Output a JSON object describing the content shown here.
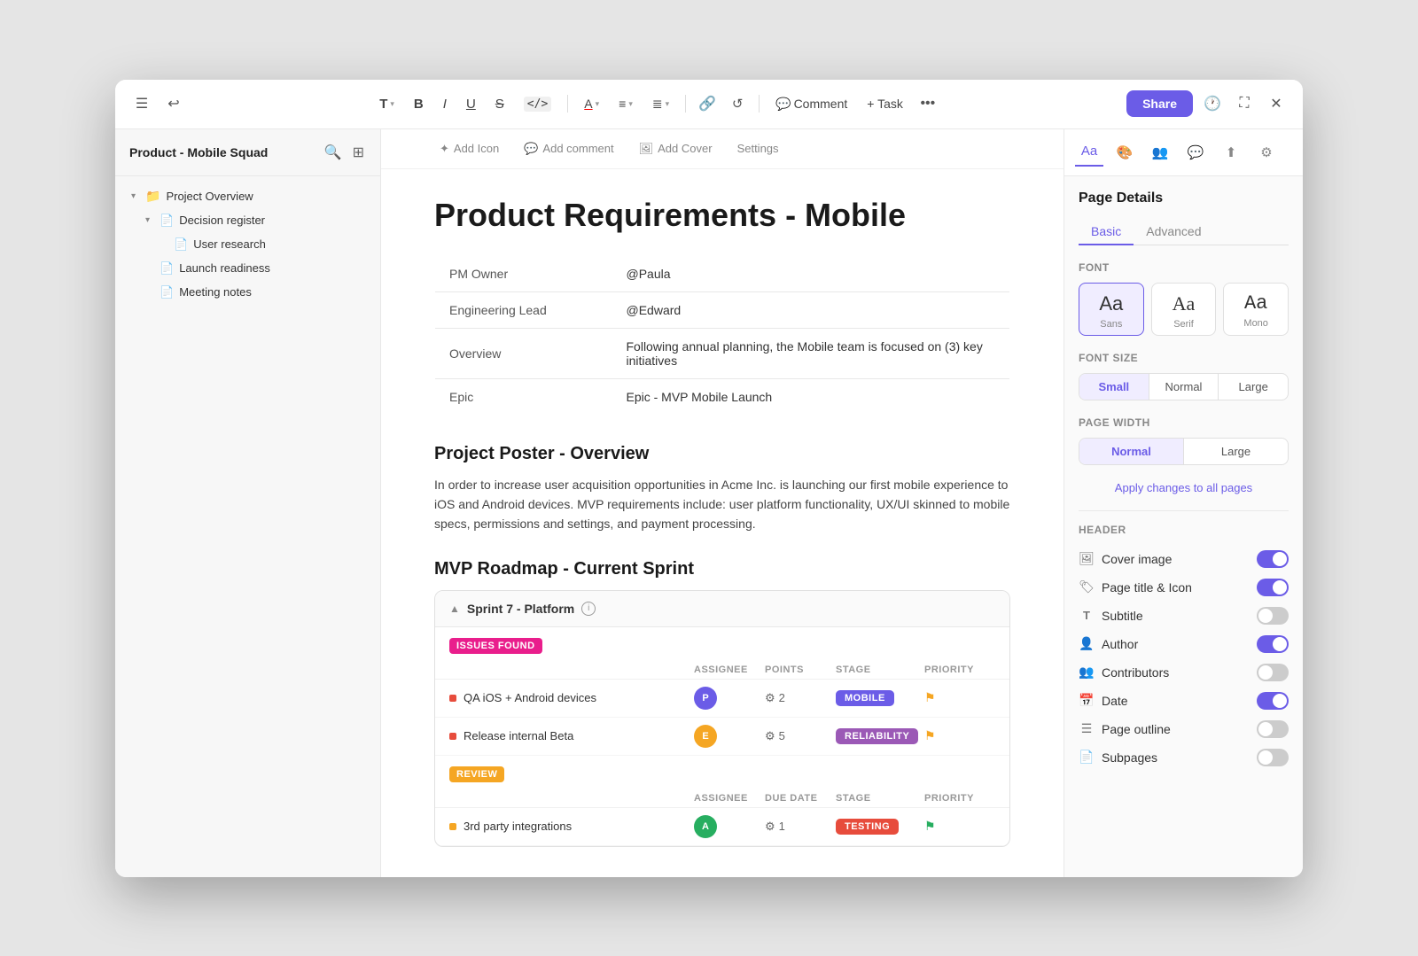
{
  "window": {
    "title": "Product - Mobile Squad"
  },
  "toolbar": {
    "undo_label": "↩",
    "menu_label": "☰",
    "text_label": "T",
    "bold_label": "B",
    "italic_label": "I",
    "underline_label": "U",
    "strike_label": "S",
    "code_label": "</>",
    "font_color_label": "A",
    "align_label": "≡",
    "list_label": "≣",
    "link_label": "🔗",
    "loop_label": "↺",
    "comment_label": "Comment",
    "task_label": "+ Task",
    "more_label": "•••",
    "share_label": "Share",
    "history_label": "🕐",
    "expand_label": "⛶",
    "close_label": "✕"
  },
  "sidebar": {
    "title": "Product - Mobile Squad",
    "tree": [
      {
        "id": "project-overview",
        "label": "Project Overview",
        "type": "folder",
        "expanded": true,
        "level": 0,
        "children": [
          {
            "id": "decision-register",
            "label": "Decision register",
            "type": "page",
            "level": 1,
            "expanded": true,
            "children": [
              {
                "id": "user-research",
                "label": "User research",
                "type": "page",
                "level": 2
              }
            ]
          },
          {
            "id": "launch-readiness",
            "label": "Launch readiness",
            "type": "page",
            "level": 1
          },
          {
            "id": "meeting-notes",
            "label": "Meeting notes",
            "type": "page",
            "level": 1
          }
        ]
      }
    ]
  },
  "doc_toolbar": {
    "add_icon": "Add Icon",
    "add_comment": "Add comment",
    "add_cover": "Add Cover",
    "settings": "Settings"
  },
  "doc": {
    "title": "Product Requirements - Mobile",
    "info_rows": [
      {
        "label": "PM Owner",
        "value": "@Paula"
      },
      {
        "label": "Engineering Lead",
        "value": "@Edward"
      },
      {
        "label": "Overview",
        "value": "Following annual planning, the Mobile team is focused on (3) key initiatives"
      },
      {
        "label": "Epic",
        "value": "Epic - MVP Mobile Launch"
      }
    ],
    "section1_title": "Project Poster - Overview",
    "section1_text": "In order to increase user acquisition opportunities in Acme Inc. is launching our first mobile experience to iOS and Android devices. MVP requirements include: user platform functionality, UX/UI skinned to mobile specs, permissions and settings, and payment processing.",
    "section2_title": "MVP Roadmap - Current Sprint",
    "sprint": {
      "title": "Sprint  7 - Platform",
      "groups": [
        {
          "tag": "ISSUES FOUND",
          "tag_type": "issues",
          "columns": [
            "",
            "ASSIGNEE",
            "POINTS",
            "STAGE",
            "PRIORITY"
          ],
          "tasks": [
            {
              "name": "QA iOS + Android devices",
              "dot_color": "red",
              "assignee_initials": "P",
              "assignee_color": "blue",
              "points": "2",
              "stage": "MOBILE",
              "stage_class": "stage-mobile",
              "priority_color": "🟡"
            },
            {
              "name": "Release internal Beta",
              "dot_color": "red",
              "assignee_initials": "E",
              "assignee_color": "orange",
              "points": "5",
              "stage": "RELIABILITY",
              "stage_class": "stage-reliability",
              "priority_color": "🟡"
            }
          ]
        },
        {
          "tag": "REVIEW",
          "tag_type": "review",
          "columns": [
            "",
            "ASSIGNEE",
            "DUE DATE",
            "STAGE",
            "PRIORITY"
          ],
          "tasks": [
            {
              "name": "3rd party integrations",
              "dot_color": "yellow",
              "assignee_initials": "A",
              "assignee_color": "green",
              "points": "1",
              "stage": "TESTING",
              "stage_class": "stage-testing",
              "priority_color": "🟩"
            }
          ]
        }
      ]
    }
  },
  "right_panel": {
    "title": "Page Details",
    "tabs": [
      "Basic",
      "Advanced"
    ],
    "active_tab": "Basic",
    "font_section_label": "Font",
    "fonts": [
      {
        "label": "Sans",
        "preview": "Aa",
        "style": "sans",
        "selected": true
      },
      {
        "label": "Serif",
        "preview": "Aa",
        "style": "serif",
        "selected": false
      },
      {
        "label": "Mono",
        "preview": "Aa",
        "style": "mono",
        "selected": false
      }
    ],
    "font_size_label": "Font Size",
    "font_sizes": [
      {
        "label": "Small",
        "selected": true
      },
      {
        "label": "Normal",
        "selected": false
      },
      {
        "label": "Large",
        "selected": false
      }
    ],
    "page_width_label": "Page Width",
    "page_widths": [
      {
        "label": "Normal",
        "selected": true
      },
      {
        "label": "Large",
        "selected": false
      }
    ],
    "apply_link": "Apply changes to all pages",
    "header_label": "HEADER",
    "toggles": [
      {
        "label": "Cover image",
        "icon": "🖼",
        "state": "on"
      },
      {
        "label": "Page title & Icon",
        "icon": "🏷",
        "state": "on"
      },
      {
        "label": "Subtitle",
        "icon": "T̲",
        "state": "off"
      },
      {
        "label": "Author",
        "icon": "👤",
        "state": "on"
      },
      {
        "label": "Contributors",
        "icon": "👥",
        "state": "off"
      },
      {
        "label": "Date",
        "icon": "📅",
        "state": "on"
      },
      {
        "label": "Page outline",
        "icon": "☰",
        "state": "off"
      },
      {
        "label": "Subpages",
        "icon": "📄",
        "state": "off"
      }
    ]
  }
}
